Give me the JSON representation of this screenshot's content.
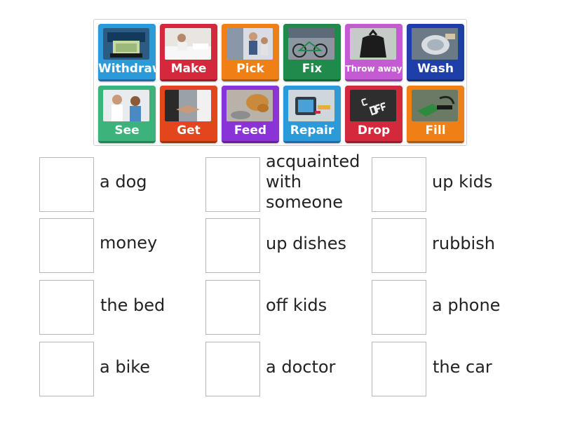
{
  "tiles": [
    {
      "label": "Withdraw",
      "color": "#2b9ad8",
      "icon": "atm-cash-icon"
    },
    {
      "label": "Make",
      "color": "#d4283d",
      "icon": "bed-making-icon"
    },
    {
      "label": "Pick",
      "color": "#f07f15",
      "icon": "pickup-kids-icon"
    },
    {
      "label": "Fix",
      "color": "#1f8a4a",
      "icon": "bike-workshop-icon"
    },
    {
      "label": "Throw away",
      "color": "#c45bd3",
      "icon": "rubbish-bag-icon"
    },
    {
      "label": "Wash",
      "color": "#1e3fa8",
      "icon": "dish-washing-icon"
    },
    {
      "label": "See",
      "color": "#3bb37a",
      "icon": "doctor-visit-icon"
    },
    {
      "label": "Get",
      "color": "#e3461c",
      "icon": "handshake-icon"
    },
    {
      "label": "Feed",
      "color": "#8a33d6",
      "icon": "dog-bowl-icon"
    },
    {
      "label": "Repair",
      "color": "#2b9ad8",
      "icon": "phone-repair-icon"
    },
    {
      "label": "Drop",
      "color": "#d4283d",
      "icon": "drop-off-sign-icon"
    },
    {
      "label": "Fill",
      "color": "#f07f15",
      "icon": "fuel-nozzle-icon"
    }
  ],
  "targets": [
    {
      "phrase": "a dog"
    },
    {
      "phrase": "acquainted with someone"
    },
    {
      "phrase": "up kids"
    },
    {
      "phrase": "money"
    },
    {
      "phrase": "up dishes"
    },
    {
      "phrase": "rubbish"
    },
    {
      "phrase": "the bed"
    },
    {
      "phrase": "off kids"
    },
    {
      "phrase": "a phone"
    },
    {
      "phrase": "a bike"
    },
    {
      "phrase": "a doctor"
    },
    {
      "phrase": "the car"
    }
  ]
}
